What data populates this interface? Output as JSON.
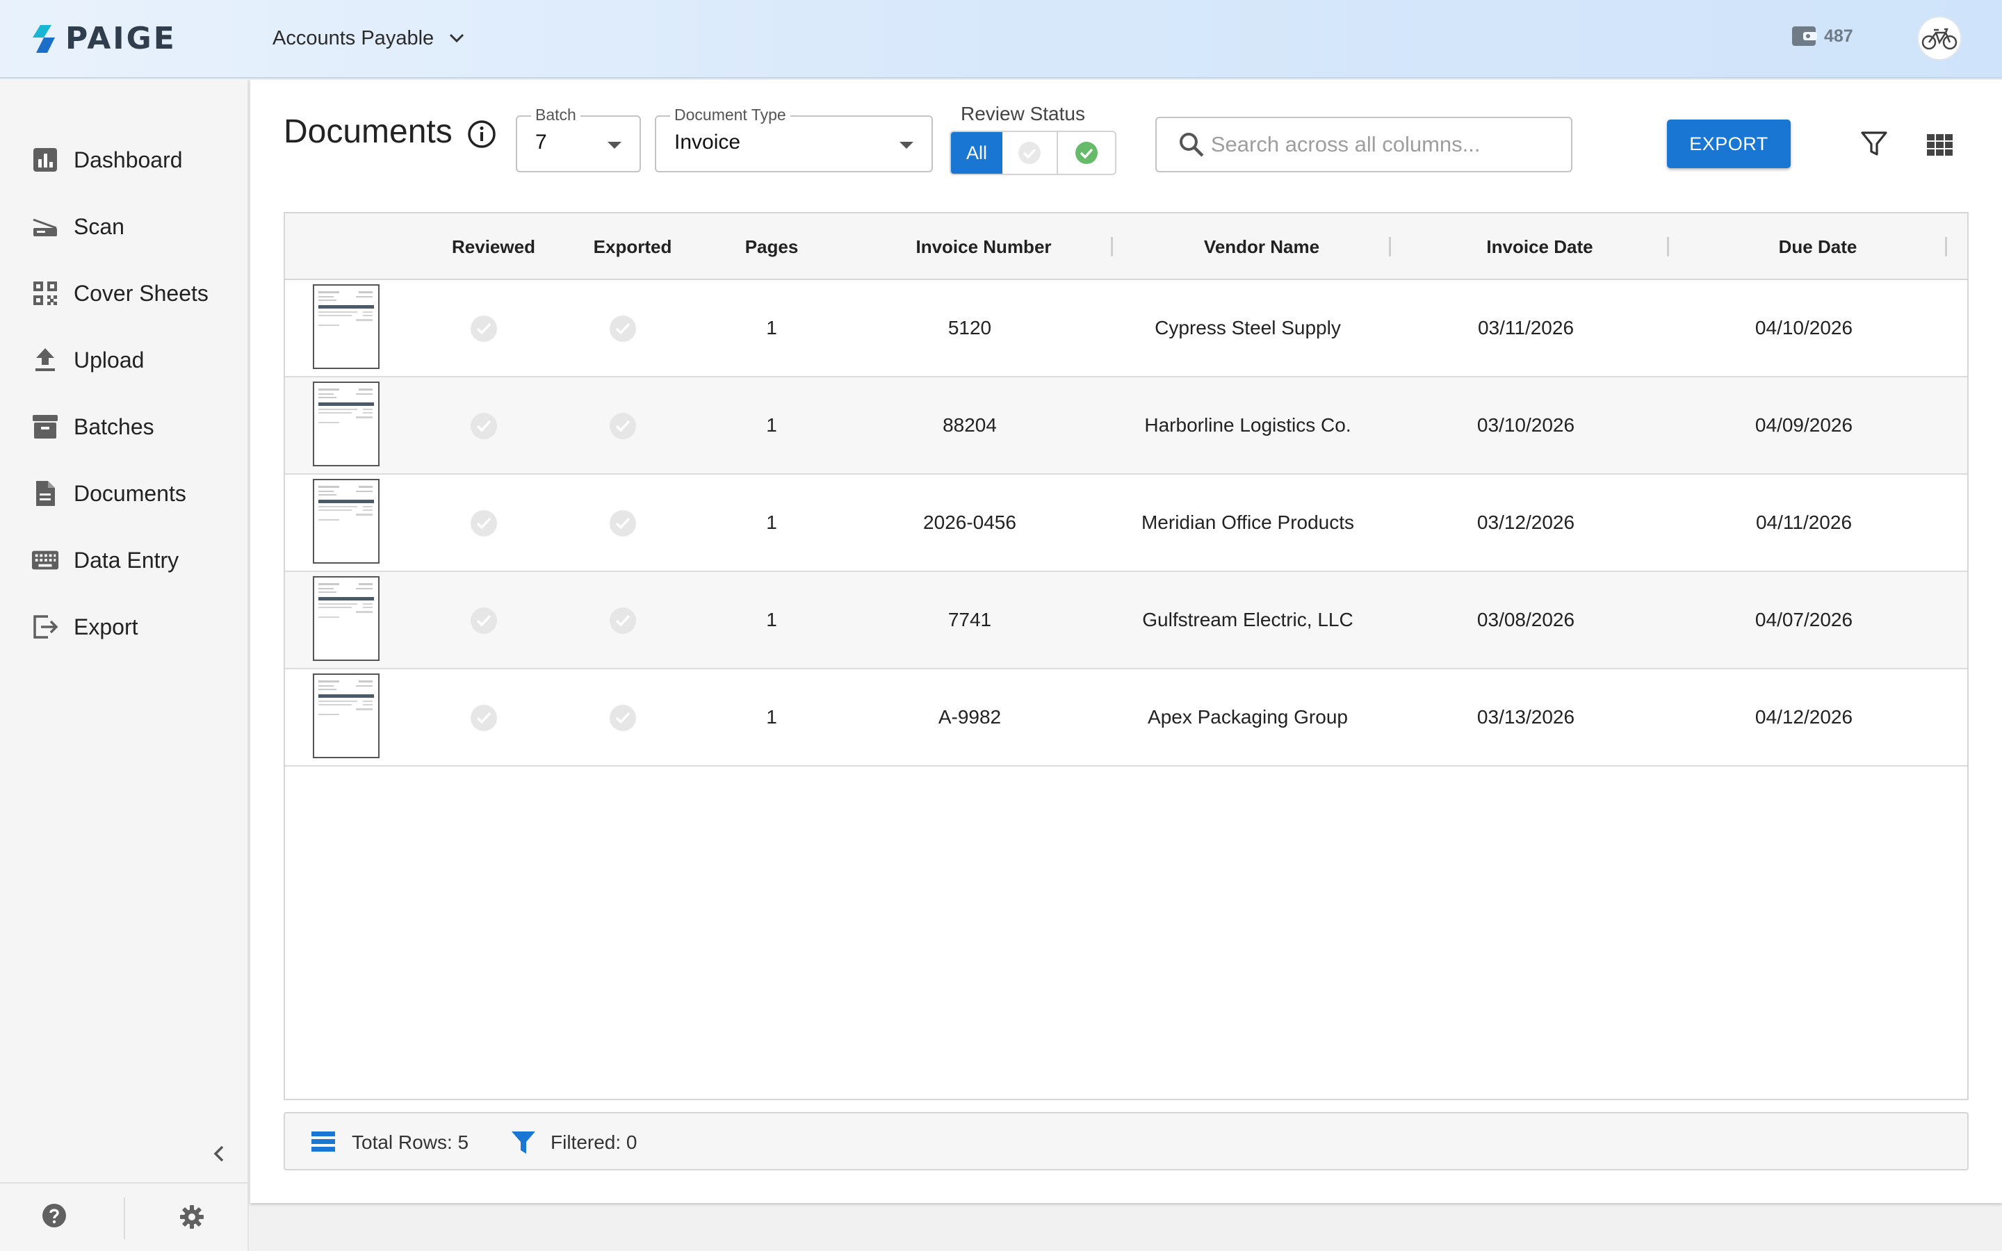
{
  "app": {
    "logo": "PAIGE",
    "workspace": "Accounts Payable",
    "credits": "487"
  },
  "sidebar": {
    "items": [
      {
        "label": "Dashboard",
        "icon": "bar-chart-icon"
      },
      {
        "label": "Scan",
        "icon": "scanner-icon"
      },
      {
        "label": "Cover Sheets",
        "icon": "qr-code-icon"
      },
      {
        "label": "Upload",
        "icon": "upload-icon"
      },
      {
        "label": "Batches",
        "icon": "archive-icon"
      },
      {
        "label": "Documents",
        "icon": "document-icon"
      },
      {
        "label": "Data Entry",
        "icon": "keyboard-icon"
      },
      {
        "label": "Export",
        "icon": "export-icon"
      }
    ]
  },
  "page": {
    "title": "Documents"
  },
  "filters": {
    "batch": {
      "label": "Batch",
      "value": "7"
    },
    "doc_type": {
      "label": "Document Type",
      "value": "Invoice"
    },
    "review_status": {
      "label": "Review Status",
      "options": [
        "All",
        "unreviewed",
        "reviewed"
      ],
      "selected": "All"
    },
    "search": {
      "placeholder": "Search across all columns..."
    }
  },
  "toolbar": {
    "export_label": "EXPORT"
  },
  "table": {
    "columns": [
      "",
      "Reviewed",
      "Exported",
      "Pages",
      "Invoice Number",
      "Vendor Name",
      "Invoice Date",
      "Due Date"
    ],
    "rows": [
      {
        "pages": "1",
        "invoice_number": "5120",
        "vendor": "Cypress Steel Supply",
        "invoice_date": "03/11/2026",
        "due_date": "04/10/2026"
      },
      {
        "pages": "1",
        "invoice_number": "88204",
        "vendor": "Harborline Logistics Co.",
        "invoice_date": "03/10/2026",
        "due_date": "04/09/2026"
      },
      {
        "pages": "1",
        "invoice_number": "2026-0456",
        "vendor": "Meridian Office Products",
        "invoice_date": "03/12/2026",
        "due_date": "04/11/2026"
      },
      {
        "pages": "1",
        "invoice_number": "7741",
        "vendor": "Gulfstream Electric, LLC",
        "invoice_date": "03/08/2026",
        "due_date": "04/07/2026"
      },
      {
        "pages": "1",
        "invoice_number": "A-9982",
        "vendor": "Apex Packaging Group",
        "invoice_date": "03/13/2026",
        "due_date": "04/12/2026"
      }
    ]
  },
  "status_bar": {
    "total_rows": "Total Rows: 5",
    "filtered": "Filtered: 0"
  },
  "colors": {
    "accent": "#1976d2",
    "reviewed_green": "#66bb6a",
    "check_grey": "#e6e6e6"
  }
}
